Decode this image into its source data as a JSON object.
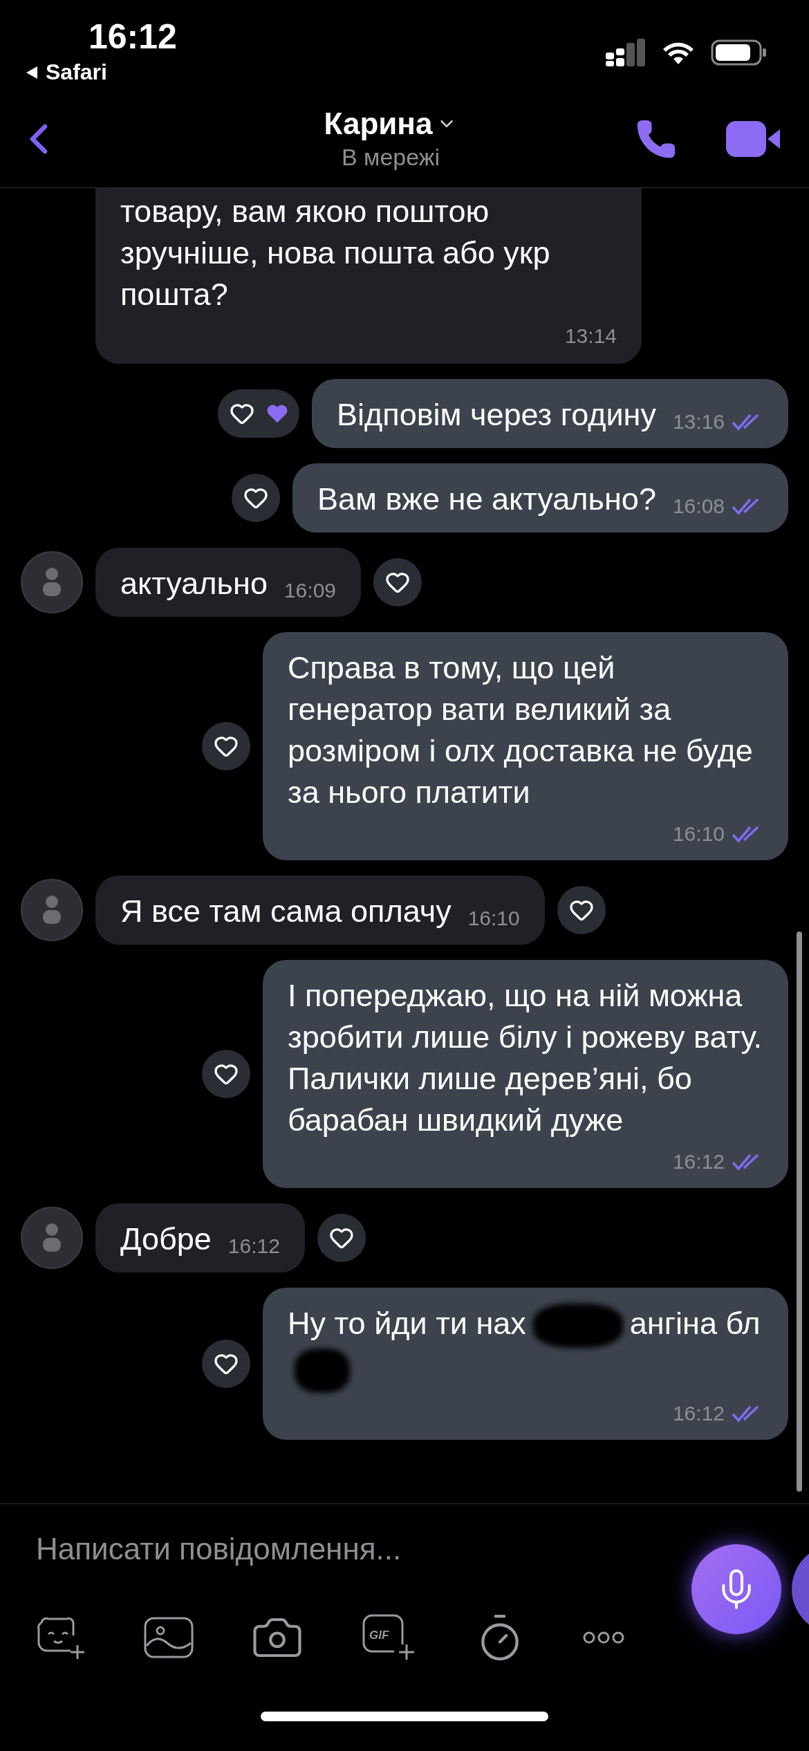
{
  "status_bar": {
    "time": "16:12",
    "back_label": "Safari"
  },
  "header": {
    "title": "Карина",
    "subtitle": "В мережі"
  },
  "messages": [
    {
      "kind": "incoming",
      "text": "товару, вам якою поштою зручніше, нова пошта або укр пошта?",
      "time": "13:14"
    },
    {
      "kind": "outgoing",
      "text": "Відповім через годину",
      "time": "13:16",
      "seen": true,
      "heart": true,
      "liked": true
    },
    {
      "kind": "outgoing",
      "text": "Вам вже не актуально?",
      "time": "16:08",
      "seen": true,
      "heart": true,
      "liked": false
    },
    {
      "kind": "incoming",
      "avatar": true,
      "text": "актуально",
      "time": "16:09",
      "heart": true,
      "liked": false
    },
    {
      "kind": "outgoing",
      "text": "Справа в тому, що цей генератор вати великий за розміром і олх доставка не буде за нього платити",
      "time": "16:10",
      "seen": true,
      "heart": true,
      "liked": false
    },
    {
      "kind": "incoming",
      "avatar": true,
      "text": "Я все там сама оплачу",
      "time": "16:10",
      "heart": true,
      "liked": false
    },
    {
      "kind": "outgoing",
      "text": "І попереджаю, що на ній можна зробити лише білу і рожеву вату. Палички лише дерев’яні, бо барабан швидкий дуже",
      "time": "16:12",
      "seen": true,
      "heart": true,
      "liked": false
    },
    {
      "kind": "incoming",
      "avatar": true,
      "text": "Добре",
      "time": "16:12",
      "heart": true,
      "liked": false
    },
    {
      "kind": "redacted",
      "parts": [
        "Ну то йди ти нах",
        "ангіна",
        "бл"
      ],
      "time": "16:12",
      "seen": true,
      "heart": true,
      "liked": false
    }
  ],
  "composer": {
    "placeholder": "Написати повідомлення...",
    "gif_label": "GIF"
  },
  "toolbar": [
    {
      "kind": "sticker"
    },
    {
      "kind": "gallery"
    },
    {
      "kind": "camera"
    },
    {
      "kind": "gif"
    },
    {
      "kind": "timer"
    },
    {
      "kind": "more"
    }
  ]
}
